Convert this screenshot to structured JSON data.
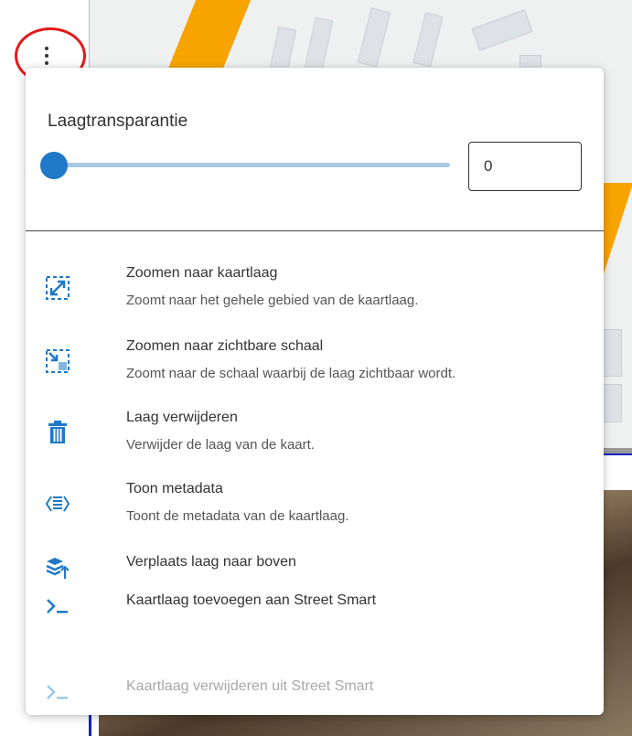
{
  "menu": {
    "transparency_label": "Laagtransparantie",
    "transparency_value": "0",
    "transparency_percent": 0,
    "items": [
      {
        "name": "Zoomen naar kaartlaag",
        "desc": "Zoomt naar het gehele gebied van de kaartlaag.",
        "icon": "zoom-extent-icon"
      },
      {
        "name": "Zoomen naar zichtbare schaal",
        "desc": "Zoomt naar de schaal waarbij de laag zichtbaar wordt.",
        "icon": "zoom-scale-icon"
      },
      {
        "name": "Laag verwijderen",
        "desc": "Verwijder de laag van de kaart.",
        "icon": "trash-icon"
      },
      {
        "name": "Toon metadata",
        "desc": "Toont de metadata van de kaartlaag.",
        "icon": "metadata-icon"
      },
      {
        "name": "Verplaats laag naar boven",
        "icon": "layers-up-icon"
      },
      {
        "name": "Kaartlaag toevoegen aan Street Smart",
        "icon": "terminal-icon"
      },
      {
        "name": "Kaartlaag verwijderen uit Street Smart",
        "icon": "terminal-icon",
        "disabled": true
      }
    ]
  },
  "colors": {
    "accent": "#1f78c8",
    "highlight_ring": "#e31a1a",
    "map_road": "#f7a400"
  }
}
